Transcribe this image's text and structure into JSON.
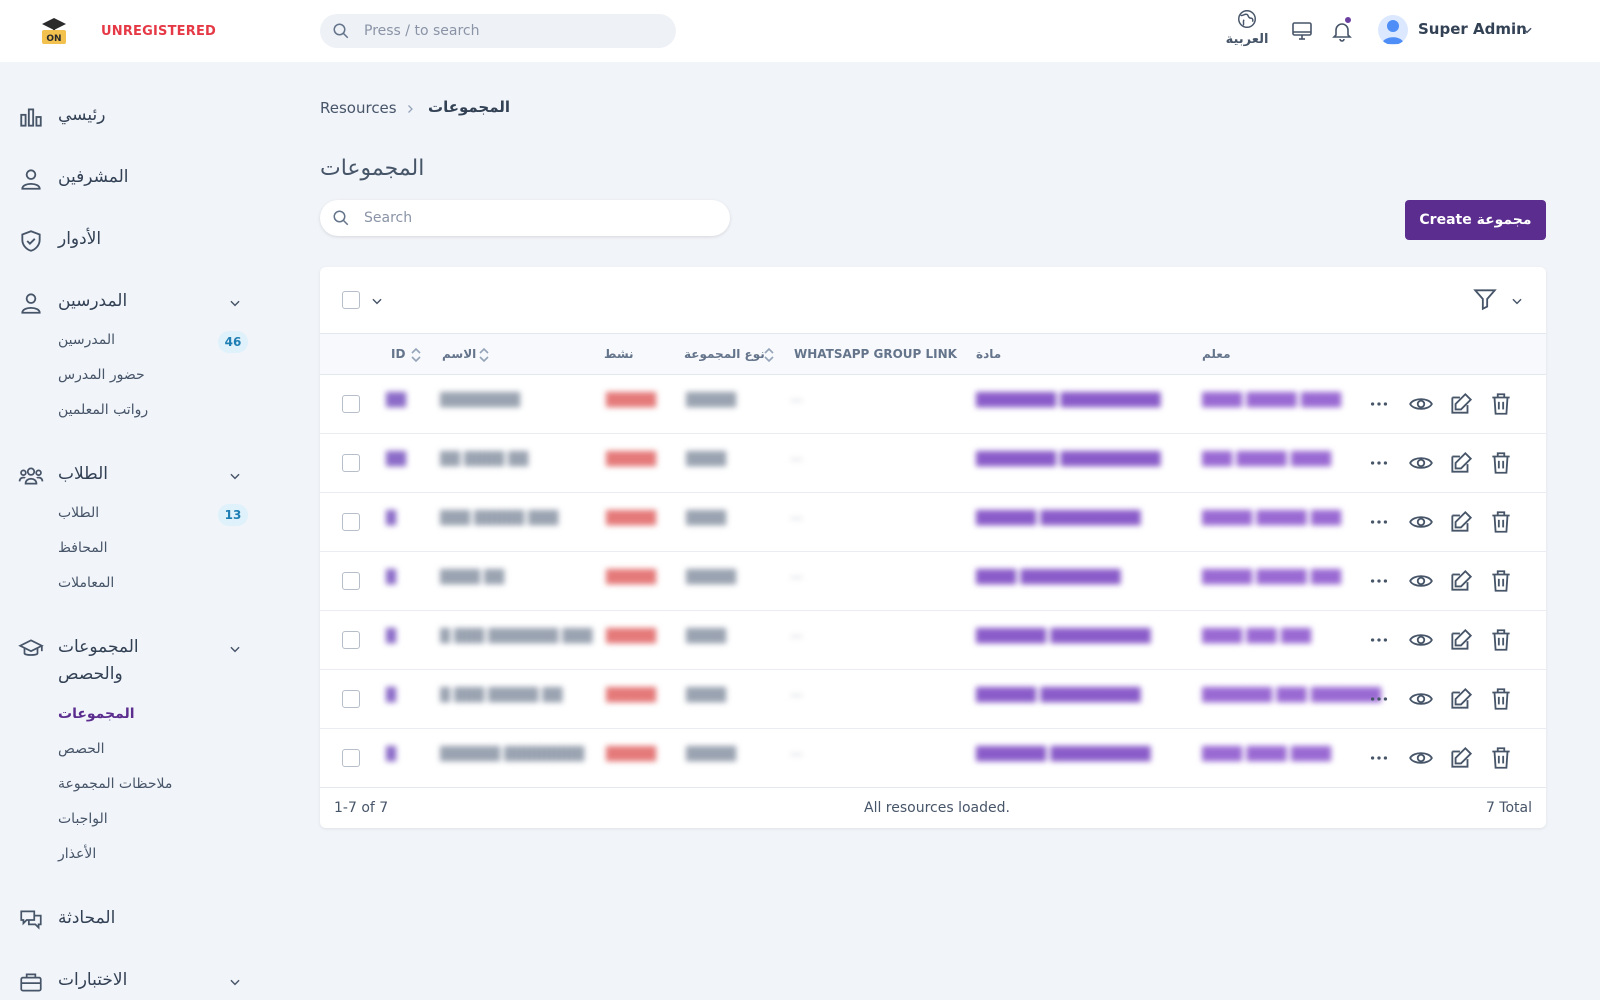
{
  "header": {
    "unregistered": "UNREGISTERED",
    "search_placeholder": "Press / to search",
    "language": "العربية",
    "user_name": "Super Admin",
    "logo_text": "ON"
  },
  "sidebar": {
    "home": "رئيسي",
    "supervisors": "المشرفين",
    "roles": "الأدوار",
    "teachers_group": "المدرسين",
    "teachers_sub": [
      "المدرسين",
      "حضور المدرس",
      "رواتب المعلمين"
    ],
    "teachers_badge": "46",
    "students_group": "الطلاب",
    "students_sub": [
      "الطلاب",
      "المحافظ",
      "المعاملات"
    ],
    "students_badge": "13",
    "groups_group_line1": "المجموعات",
    "groups_group_line2": "والحصص",
    "groups_sub": [
      "المجموعات",
      "الحصص",
      "ملاحظات المجموعة",
      "الواجبات",
      "الأعذار"
    ],
    "chat": "المحادثة",
    "exams": "الاختبارات"
  },
  "main": {
    "breadcrumb_root": "Resources",
    "breadcrumb_current": "المجموعات",
    "page_title": "المجموعات",
    "search_placeholder": "Search",
    "create_button": "Create مجموعة",
    "columns": {
      "id": "ID",
      "name": "الاسم",
      "active": "نشط",
      "group_type": "نوع المجموعة",
      "whatsapp": "WHATSAPP GROUP LINK",
      "subject": "مادة",
      "teacher": "معلم"
    },
    "rows": [
      {
        "id": "██",
        "name": "████████",
        "active": "█████",
        "type": "█████",
        "wa": "—",
        "subject": "████████ ██████████",
        "teacher": "████ █████ ████"
      },
      {
        "id": "██",
        "name": "██ ████ ██",
        "active": "█████",
        "type": "████",
        "wa": "—",
        "subject": "████████ ██████████",
        "teacher": "███ █████ ████"
      },
      {
        "id": "█",
        "name": "███ █████ ███",
        "active": "█████",
        "type": "████",
        "wa": "—",
        "subject": "██████ ██████████",
        "teacher": "█████ █████ ███"
      },
      {
        "id": "█",
        "name": "████ ██",
        "active": "█████",
        "type": "█████",
        "wa": "—",
        "subject": "████ ██████████",
        "teacher": "█████ █████ ███"
      },
      {
        "id": "█",
        "name": "█ ███ ███████ ███",
        "active": "█████",
        "type": "████",
        "wa": "—",
        "subject": "███████ ██████████",
        "teacher": "████ ███ ███"
      },
      {
        "id": "█",
        "name": "█ ███ █████ ██",
        "active": "█████",
        "type": "████",
        "wa": "—",
        "subject": "██████ ██████████",
        "teacher": "███████ ███ ███████"
      },
      {
        "id": "█",
        "name": "██████ ████████",
        "active": "█████",
        "type": "█████",
        "wa": "—",
        "subject": "███████ ██████████",
        "teacher": "████ ████ ████"
      }
    ],
    "footer_range": "1-7 of 7",
    "footer_status": "All resources loaded.",
    "footer_total": "7 Total"
  }
}
